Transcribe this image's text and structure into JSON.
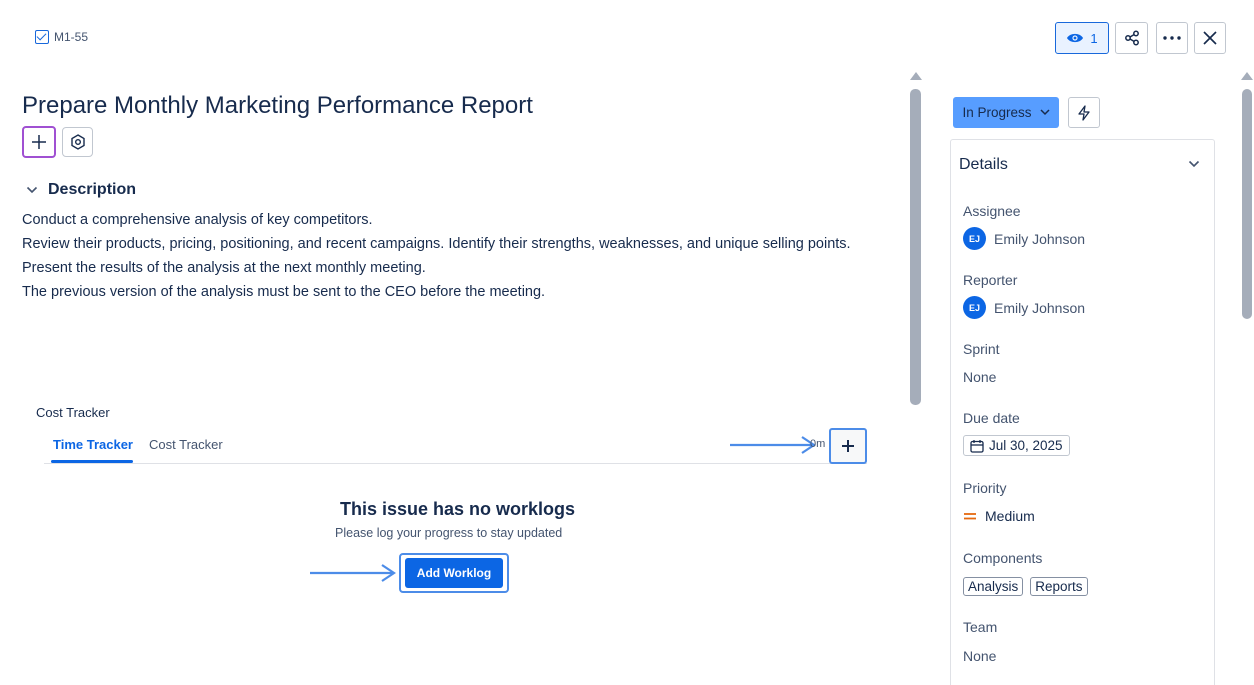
{
  "header": {
    "issue_key": "M1-55",
    "watch_count": "1"
  },
  "issue": {
    "title": "Prepare Monthly Marketing Performance Report"
  },
  "description": {
    "heading": "Description",
    "lines": [
      "Conduct a comprehensive analysis of key competitors.",
      "Review their products, pricing, positioning, and recent campaigns. Identify their strengths, weaknesses, and unique selling points.",
      "Present the results of the analysis at the next monthly meeting.",
      "The previous version of the analysis must be sent to the CEO before the meeting."
    ]
  },
  "cost_tracker": {
    "section_title": "Cost Tracker",
    "tabs": [
      "Time Tracker",
      "Cost Tracker"
    ],
    "active_tab": "Time Tracker",
    "total": "0m",
    "empty_title": "This issue has no worklogs",
    "empty_subtitle": "Please log your progress to stay updated",
    "add_worklog_label": "Add Worklog"
  },
  "sidebar": {
    "status": "In Progress",
    "details_title": "Details",
    "fields": {
      "assignee_label": "Assignee",
      "assignee_initials": "EJ",
      "assignee_name": "Emily Johnson",
      "reporter_label": "Reporter",
      "reporter_initials": "EJ",
      "reporter_name": "Emily Johnson",
      "sprint_label": "Sprint",
      "sprint_value": "None",
      "due_label": "Due date",
      "due_value": "Jul 30, 2025",
      "priority_label": "Priority",
      "priority_value": "Medium",
      "components_label": "Components",
      "components": [
        "Analysis",
        "Reports"
      ],
      "team_label": "Team",
      "team_value": "None"
    }
  },
  "colors": {
    "primary": "#0c66e4",
    "status_bg": "#579dff",
    "highlight_border": "#4c8ce8",
    "add_border": "#a050d2",
    "priority_medium": "#e56910"
  },
  "icons": [
    "checkbox-icon",
    "eye-icon",
    "share-icon",
    "more-icon",
    "close-icon",
    "plus-icon",
    "gear-icon",
    "chevron-down-icon",
    "bolt-icon",
    "calendar-icon",
    "priority-medium-icon",
    "arrow-right-icon"
  ]
}
